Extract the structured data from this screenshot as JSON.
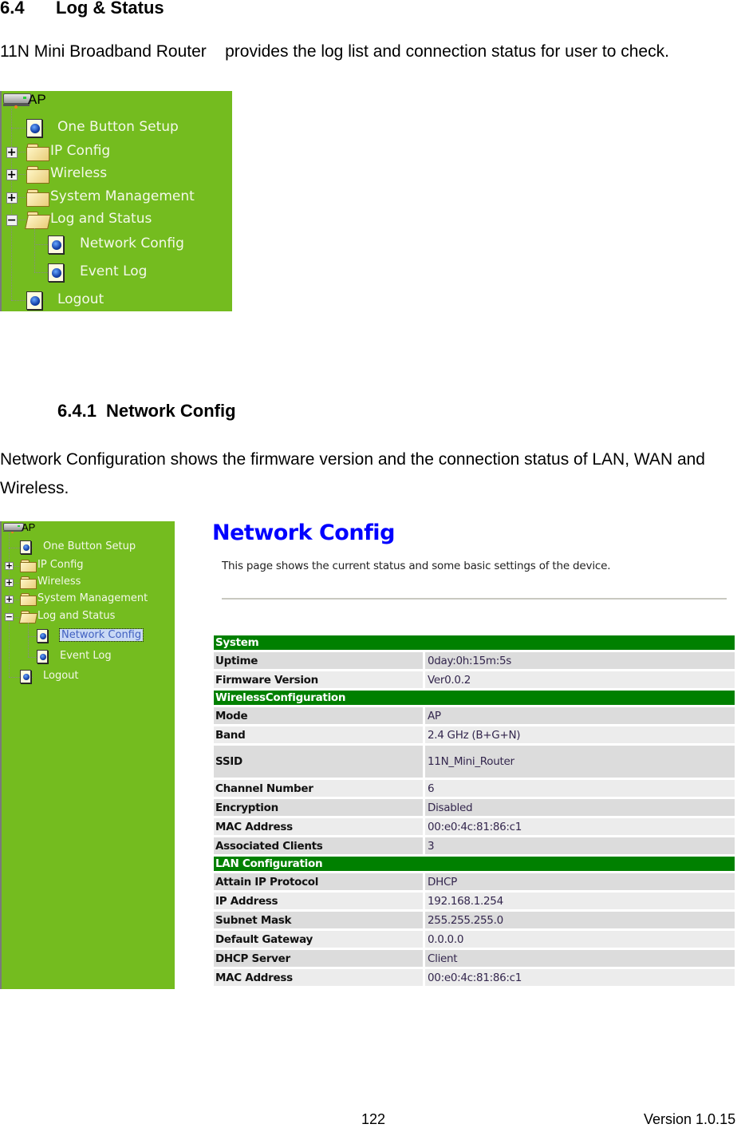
{
  "section": {
    "number": "6.4",
    "title": "Log & Status",
    "intro": "11N Mini Broadband Router    provides the log list and connection status for user to check."
  },
  "subsection": {
    "number": "6.4.1",
    "title": "Network Config",
    "paragraph": "Network Configuration shows the firmware version and the connection status of LAN, WAN and Wireless."
  },
  "menu_tree": {
    "root": "AP",
    "items": [
      {
        "label": "One Button Setup",
        "type": "page",
        "icon": "page-globe-icon"
      },
      {
        "label": "IP Config",
        "type": "folder",
        "expanded": false,
        "icon": "folder-icon"
      },
      {
        "label": "Wireless",
        "type": "folder",
        "expanded": false,
        "icon": "folder-icon"
      },
      {
        "label": "System Management",
        "type": "folder",
        "expanded": false,
        "icon": "folder-icon"
      },
      {
        "label": "Log and Status",
        "type": "folder",
        "expanded": true,
        "icon": "folder-open-icon",
        "children": [
          {
            "label": "Network Config",
            "icon": "page-globe-icon"
          },
          {
            "label": "Event Log",
            "icon": "page-globe-icon"
          }
        ]
      },
      {
        "label": "Logout",
        "type": "page",
        "icon": "page-globe-icon"
      }
    ],
    "selected_in_screenshot_2": "Network Config",
    "colors": {
      "background": "#74bc1f",
      "text": "#f4f8ea"
    }
  },
  "network_config": {
    "title": "Network Config",
    "description": "This page shows the current status and some basic settings of the device.",
    "colors": {
      "title": "#0000ff",
      "section_header": "#008000",
      "row_dark": "#dcdcdc",
      "row_light": "#ececec"
    },
    "sections": [
      {
        "header": "System",
        "rows": [
          {
            "key": "Uptime",
            "value": "0day:0h:15m:5s"
          },
          {
            "key": "Firmware Version",
            "value": "Ver0.0.2"
          }
        ]
      },
      {
        "header": "WirelessConfiguration",
        "rows": [
          {
            "key": "Mode",
            "value": "AP"
          },
          {
            "key": "Band",
            "value": "2.4 GHz (B+G+N)"
          },
          {
            "key": "SSID",
            "value": "11N_Mini_Router"
          },
          {
            "key": "Channel Number",
            "value": "6"
          },
          {
            "key": "Encryption",
            "value": "Disabled"
          },
          {
            "key": "MAC Address",
            "value": "00:e0:4c:81:86:c1"
          },
          {
            "key": "Associated Clients",
            "value": "3"
          }
        ]
      },
      {
        "header": "LAN Configuration",
        "rows": [
          {
            "key": "Attain IP Protocol",
            "value": "DHCP"
          },
          {
            "key": "IP Address",
            "value": "192.168.1.254"
          },
          {
            "key": "Subnet Mask",
            "value": "255.255.255.0"
          },
          {
            "key": "Default Gateway",
            "value": "0.0.0.0"
          },
          {
            "key": "DHCP Server",
            "value": "Client"
          },
          {
            "key": "MAC Address",
            "value": "00:e0:4c:81:86:c1"
          }
        ]
      }
    ]
  },
  "footer": {
    "page_number": "122",
    "version": "Version 1.0.15"
  }
}
